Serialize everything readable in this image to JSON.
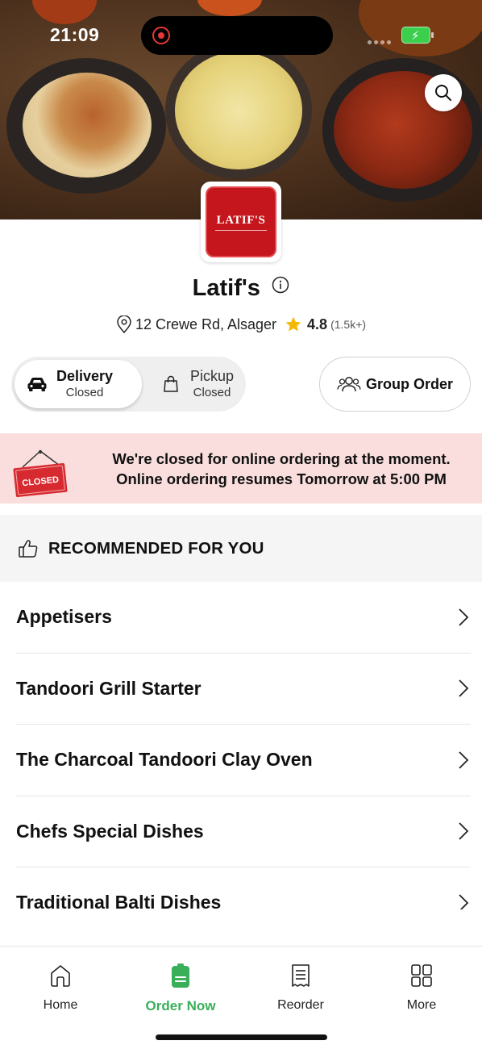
{
  "status_bar": {
    "time": "21:09"
  },
  "restaurant": {
    "logo_text": "LATIF'S",
    "name": "Latif's",
    "address": "12 Crewe Rd, Alsager",
    "rating": "4.8",
    "rating_count": "(1.5k+)"
  },
  "order_mode": {
    "delivery": {
      "label": "Delivery",
      "status": "Closed"
    },
    "pickup": {
      "label": "Pickup",
      "status": "Closed"
    },
    "selected": "delivery",
    "group_order_label": "Group Order"
  },
  "closed_banner": {
    "sign_text": "CLOSED",
    "line1": "We're closed for online ordering at the moment.",
    "line2": "Online ordering resumes Tomorrow at 5:00 PM"
  },
  "recommended": {
    "title": "RECOMMENDED FOR YOU"
  },
  "categories": [
    "Appetisers",
    "Tandoori Grill Starter",
    "The Charcoal Tandoori Clay Oven",
    "Chefs Special Dishes",
    "Traditional Balti Dishes"
  ],
  "tab_bar": {
    "tabs": [
      {
        "label": "Home",
        "icon": "home-icon"
      },
      {
        "label": "Order Now",
        "icon": "order-now-icon"
      },
      {
        "label": "Reorder",
        "icon": "receipt-icon"
      },
      {
        "label": "More",
        "icon": "grid-icon"
      }
    ],
    "active": "Order Now"
  },
  "colors": {
    "accent_green": "#3aaf5a",
    "banner_bg": "#f9dedd",
    "closed_sign_red": "#d72a30",
    "star_yellow": "#f5b800",
    "logo_red": "#c4161c"
  }
}
